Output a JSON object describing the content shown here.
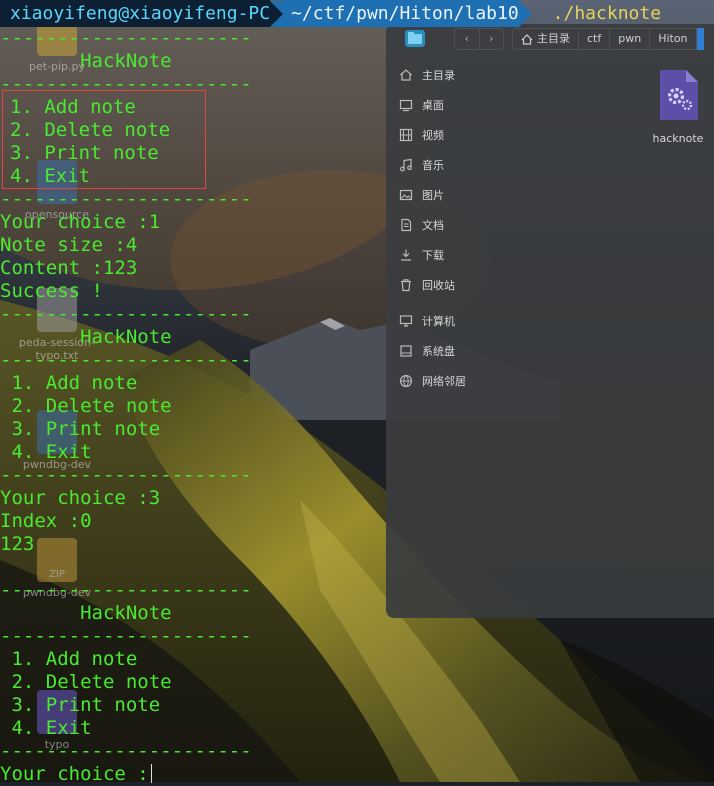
{
  "prompt": {
    "user_host": "xiaoyifeng@xiaoyifeng-PC",
    "path": "~/ctf/pwn/Hiton/lab10",
    "command": "./hacknote"
  },
  "terminal": {
    "separator": "----------------------",
    "banner_text": "       HackNote",
    "session1": {
      "menu": [
        "1. Add note",
        "2. Delete note",
        "3. Print note",
        "4. Exit"
      ],
      "output": [
        "Your choice :1",
        "Note size :4",
        "Content :123",
        "Success !"
      ]
    },
    "session2": {
      "menu": [
        " 1. Add note",
        " 2. Delete note",
        " 3. Print note",
        " 4. Exit"
      ],
      "output": [
        "Your choice :3",
        "Index :0",
        "123"
      ]
    },
    "session3": {
      "menu": [
        " 1. Add note",
        " 2. Delete note",
        " 3. Print note",
        " 4. Exit"
      ],
      "final_prompt": "Your choice :"
    }
  },
  "desktop_icons": [
    "pet-pip.py",
    "opensource",
    "peda-session-typo.txt",
    "pwndbg-dev",
    "pwndbg-dev",
    "typo"
  ],
  "desktop_icon_badge": "ZIP",
  "file_manager": {
    "breadcrumbs": [
      "主目录",
      "ctf",
      "pwn",
      "Hiton"
    ],
    "nav_back": "‹",
    "nav_forward": "›",
    "sidebar": [
      {
        "label": "主目录",
        "icon": "home-icon"
      },
      {
        "label": "桌面",
        "icon": "desktop-icon"
      },
      {
        "label": "视频",
        "icon": "video-icon"
      },
      {
        "label": "音乐",
        "icon": "music-icon"
      },
      {
        "label": "图片",
        "icon": "picture-icon"
      },
      {
        "label": "文档",
        "icon": "document-icon"
      },
      {
        "label": "下载",
        "icon": "download-icon"
      },
      {
        "label": "回收站",
        "icon": "trash-icon"
      },
      {
        "label": "计算机",
        "icon": "computer-icon"
      },
      {
        "label": "系统盘",
        "icon": "disk-icon"
      },
      {
        "label": "网络邻居",
        "icon": "network-icon"
      }
    ],
    "file": {
      "name": "hacknote",
      "icon": "executable-gear-icon"
    }
  },
  "colors": {
    "terminal_green": "#4aea30",
    "prompt_user_bg": "#0d1f33",
    "prompt_path_bg": "#1f6fb3",
    "command_yellow": "#e6d35a",
    "highlight_box": "#e0453f",
    "accent_blue": "#2f7fd8"
  }
}
